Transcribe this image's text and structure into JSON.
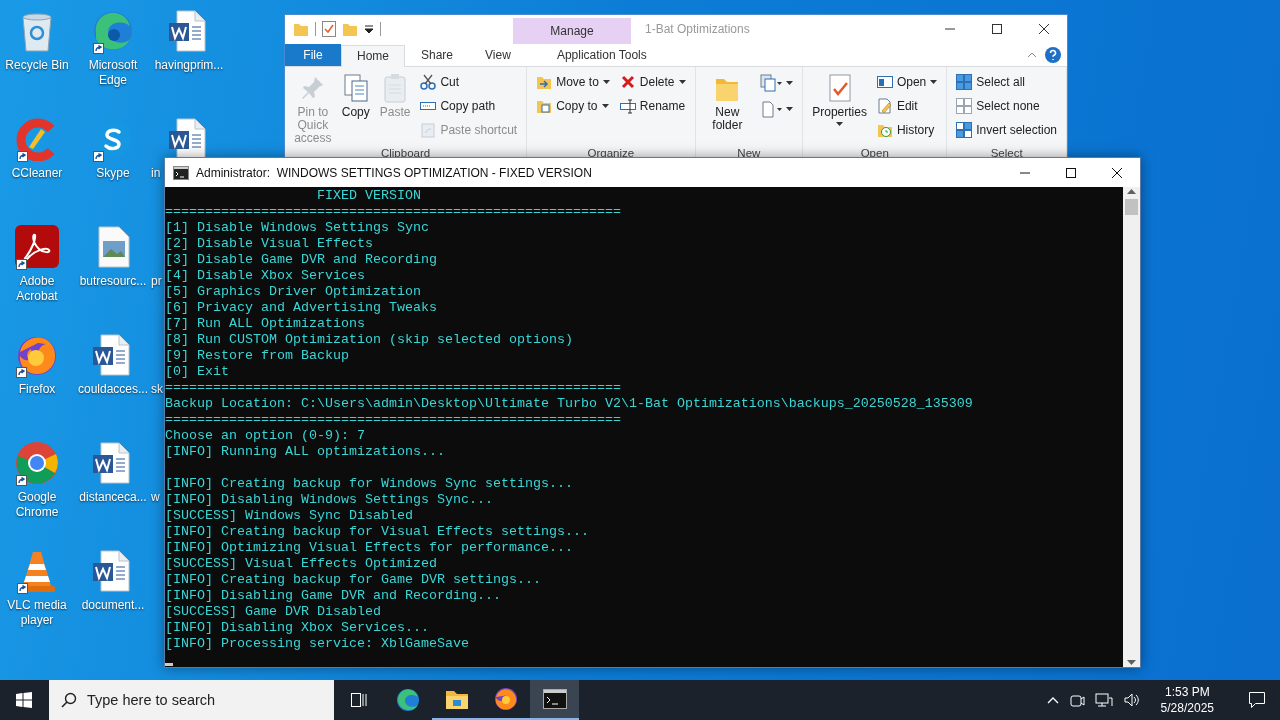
{
  "desktop": {
    "icons": [
      {
        "label": "Recycle Bin",
        "kind": "recycle",
        "shortcut": false,
        "partial": false
      },
      {
        "label": "CCleaner",
        "kind": "ccleaner",
        "shortcut": true,
        "partial": false
      },
      {
        "label": "Adobe Acrobat",
        "kind": "acrobat",
        "shortcut": true,
        "partial": false
      },
      {
        "label": "Firefox",
        "kind": "firefox",
        "shortcut": true,
        "partial": false
      },
      {
        "label": "Google Chrome",
        "kind": "chrome",
        "shortcut": true,
        "partial": false
      },
      {
        "label": "VLC media player",
        "kind": "vlc",
        "shortcut": true,
        "partial": false
      },
      {
        "label": "Microsoft Edge",
        "kind": "edge",
        "shortcut": true,
        "partial": false
      },
      {
        "label": "Skype",
        "kind": "skype",
        "shortcut": true,
        "partial": false
      },
      {
        "label": "butresourc...",
        "kind": "image",
        "shortcut": false,
        "partial": false
      },
      {
        "label": "couldacces...",
        "kind": "word",
        "shortcut": false,
        "partial": false
      },
      {
        "label": "distanceca...",
        "kind": "word",
        "shortcut": false,
        "partial": false
      },
      {
        "label": "document...",
        "kind": "word",
        "shortcut": false,
        "partial": false
      },
      {
        "label": "havingprim...",
        "kind": "word",
        "shortcut": false,
        "partial": false
      },
      {
        "label": "in",
        "kind": "word",
        "shortcut": false,
        "partial": true
      },
      {
        "label": "pr",
        "partial": true
      },
      {
        "label": "sk",
        "partial": true
      },
      {
        "label": "w",
        "partial": true
      }
    ]
  },
  "explorer": {
    "title": "1-Bat Optimizations",
    "context_tab": "Manage",
    "tabs": [
      {
        "label": "File",
        "kind": "file",
        "selected": false
      },
      {
        "label": "Home",
        "kind": "plain",
        "selected": true
      },
      {
        "label": "Share",
        "kind": "plain",
        "selected": false
      },
      {
        "label": "View",
        "kind": "plain",
        "selected": false
      },
      {
        "label": "Application Tools",
        "kind": "context",
        "selected": false
      }
    ],
    "groups": [
      {
        "label": "Clipboard",
        "columns": [
          [
            {
              "label": "Pin to Quick access",
              "kind": "pin",
              "disabled": true,
              "dropdown": false
            }
          ],
          [
            {
              "label": "Copy",
              "kind": "copy",
              "disabled": false,
              "dropdown": false
            }
          ],
          [
            {
              "label": "Paste",
              "kind": "paste",
              "disabled": true,
              "dropdown": false
            }
          ],
          [
            {
              "label": "Cut",
              "kind": "cut",
              "disabled": false,
              "dropdown": false
            },
            {
              "label": "Copy path",
              "kind": "copypath",
              "disabled": false,
              "dropdown": false
            },
            {
              "label": "Paste shortcut",
              "kind": "pasteshortcut",
              "disabled": true,
              "dropdown": false
            }
          ]
        ]
      },
      {
        "label": "Organize",
        "columns": [
          [
            {
              "label": "Move to",
              "kind": "moveto",
              "disabled": false,
              "dropdown": true
            },
            {
              "label": "Copy to",
              "kind": "copyto",
              "disabled": false,
              "dropdown": true
            }
          ],
          [
            {
              "label": "Delete",
              "kind": "delete",
              "disabled": false,
              "dropdown": true
            },
            {
              "label": "Rename",
              "kind": "rename",
              "disabled": false,
              "dropdown": false
            }
          ]
        ]
      },
      {
        "label": "New",
        "columns": [
          [
            {
              "label": "New folder",
              "kind": "newfolder",
              "disabled": false,
              "dropdown": false
            }
          ],
          [
            {
              "kind": "newitem",
              "disabled": false,
              "dropdown": true
            },
            {
              "kind": "easyaccess",
              "disabled": false,
              "dropdown": true
            }
          ]
        ]
      },
      {
        "label": "Open",
        "columns": [
          [
            {
              "label": "Properties",
              "kind": "properties",
              "disabled": false,
              "dropdown": true
            }
          ],
          [
            {
              "label": "Open",
              "kind": "open",
              "disabled": false,
              "dropdown": true
            },
            {
              "label": "Edit",
              "kind": "edit",
              "disabled": false,
              "dropdown": false
            },
            {
              "label": "History",
              "kind": "history",
              "disabled": false,
              "dropdown": false
            }
          ]
        ]
      },
      {
        "label": "Select",
        "columns": [
          [
            {
              "label": "Select all",
              "kind": "selectall",
              "disabled": false,
              "dropdown": false
            },
            {
              "label": "Select none",
              "kind": "selectnone",
              "disabled": false,
              "dropdown": false
            },
            {
              "label": "Invert selection",
              "kind": "invert",
              "disabled": false,
              "dropdown": false
            }
          ]
        ]
      }
    ]
  },
  "console": {
    "title": "Administrator:  WINDOWS SETTINGS OPTIMIZATION - FIXED VERSION",
    "blocks": [
      [
        {
          "text": "FIXED VERSION",
          "kind": "heading"
        },
        {
          "text": "=========================================================",
          "kind": "plain"
        },
        {
          "text": "[1] Disable Windows Settings Sync",
          "kind": "plain"
        },
        {
          "text": "[2] Disable Visual Effects",
          "kind": "plain"
        },
        {
          "text": "[3] Disable Game DVR and Recording",
          "kind": "plain"
        },
        {
          "text": "[4] Disable Xbox Services",
          "kind": "plain"
        },
        {
          "text": "[5] Graphics Driver Optimization",
          "kind": "plain"
        },
        {
          "text": "[6] Privacy and Advertising Tweaks",
          "kind": "plain"
        },
        {
          "text": "[7] Run ALL Optimizations",
          "kind": "plain"
        },
        {
          "text": "[8] Run CUSTOM Optimization (skip selected options)",
          "kind": "plain"
        },
        {
          "text": "[9] Restore from Backup",
          "kind": "plain"
        },
        {
          "text": "[0] Exit",
          "kind": "plain"
        },
        {
          "text": "=========================================================",
          "kind": "plain"
        },
        {
          "text": "Backup Location: C:\\Users\\admin\\Desktop\\Ultimate Turbo V2\\1-Bat Optimizations\\backups_20250528_135309",
          "kind": "plain"
        },
        {
          "text": "=========================================================",
          "kind": "plain"
        },
        {
          "text": "Choose an option (0-9): 7",
          "kind": "plain"
        },
        {
          "text": "[INFO] Running ALL optimizations...",
          "kind": "plain"
        }
      ],
      [
        {
          "text": "[INFO] Creating backup for Windows Sync settings...",
          "kind": "plain"
        },
        {
          "text": "[INFO] Disabling Windows Settings Sync...",
          "kind": "plain"
        },
        {
          "text": "[SUCCESS] Windows Sync Disabled",
          "kind": "plain"
        },
        {
          "text": "[INFO] Creating backup for Visual Effects settings...",
          "kind": "plain"
        },
        {
          "text": "[INFO] Optimizing Visual Effects for performance...",
          "kind": "plain"
        },
        {
          "text": "[SUCCESS] Visual Effects Optimized",
          "kind": "plain"
        },
        {
          "text": "[INFO] Creating backup for Game DVR settings...",
          "kind": "plain"
        },
        {
          "text": "[INFO] Disabling Game DVR and Recording...",
          "kind": "plain"
        },
        {
          "text": "[SUCCESS] Game DVR Disabled",
          "kind": "plain"
        },
        {
          "text": "[INFO] Disabling Xbox Services...",
          "kind": "plain"
        },
        {
          "text": "[INFO] Processing service: XblGameSave",
          "kind": "plain"
        }
      ]
    ]
  },
  "taskbar": {
    "search_placeholder": "Type here to search",
    "apps": [
      {
        "kind": "taskview",
        "running": false,
        "selected": false
      },
      {
        "kind": "edge",
        "running": false,
        "selected": false
      },
      {
        "kind": "explorer",
        "running": true,
        "selected": false
      },
      {
        "kind": "firefox",
        "running": true,
        "selected": false
      },
      {
        "kind": "terminal",
        "running": true,
        "selected": true
      }
    ],
    "time": "1:53 PM",
    "date": "5/28/2025"
  }
}
